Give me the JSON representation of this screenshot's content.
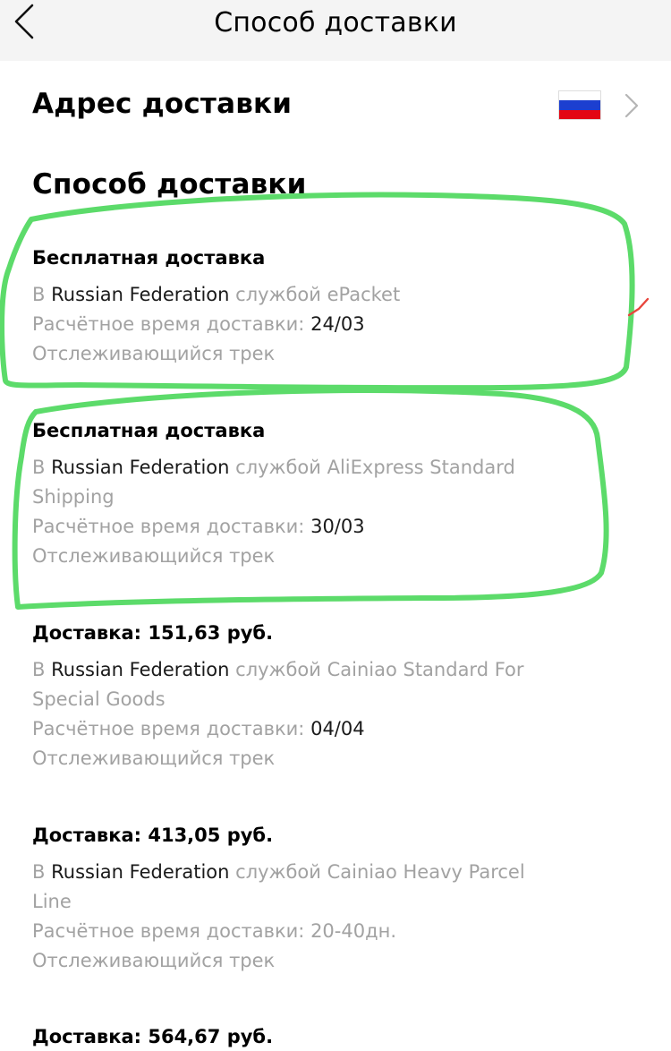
{
  "header": {
    "title": "Способ доставки",
    "back_icon": "chevron-left-icon"
  },
  "address": {
    "heading": "Адрес доставки",
    "country_flag": "russia-flag-icon",
    "chevron_icon": "chevron-right-icon"
  },
  "shipping": {
    "heading": "Способ доставки",
    "options": [
      {
        "title": "Бесплатная доставка",
        "prefix": "В",
        "country": "Russian Federation",
        "service": "службой ePacket",
        "eta_label": "Расчётное время доставки:",
        "eta_value": "24/03",
        "tracking": "Отслеживающийся трек"
      },
      {
        "title": "Бесплатная доставка",
        "prefix": "В",
        "country": "Russian Federation",
        "service": "службой AliExpress Standard Shipping",
        "eta_label": "Расчётное время доставки:",
        "eta_value": "30/03",
        "tracking": "Отслеживающийся трек"
      },
      {
        "title": "Доставка: 151,63 руб.",
        "prefix": "В",
        "country": "Russian Federation",
        "service": "службой Cainiao Standard For Special Goods",
        "eta_label": "Расчётное время доставки:",
        "eta_value": "04/04",
        "tracking": "Отслеживающийся трек"
      },
      {
        "title": "Доставка: 413,05 руб.",
        "prefix": "В",
        "country": "Russian Federation",
        "service": "службой Cainiao Heavy Parcel Line",
        "eta_label": "Расчётное время доставки: 20-40дн.",
        "eta_value": "",
        "tracking": "Отслеживающийся трек"
      },
      {
        "title": "Доставка: 564,67 руб."
      }
    ]
  },
  "annotation": {
    "highlight_color": "#5cdb6a",
    "check_color": "#e8453c"
  }
}
